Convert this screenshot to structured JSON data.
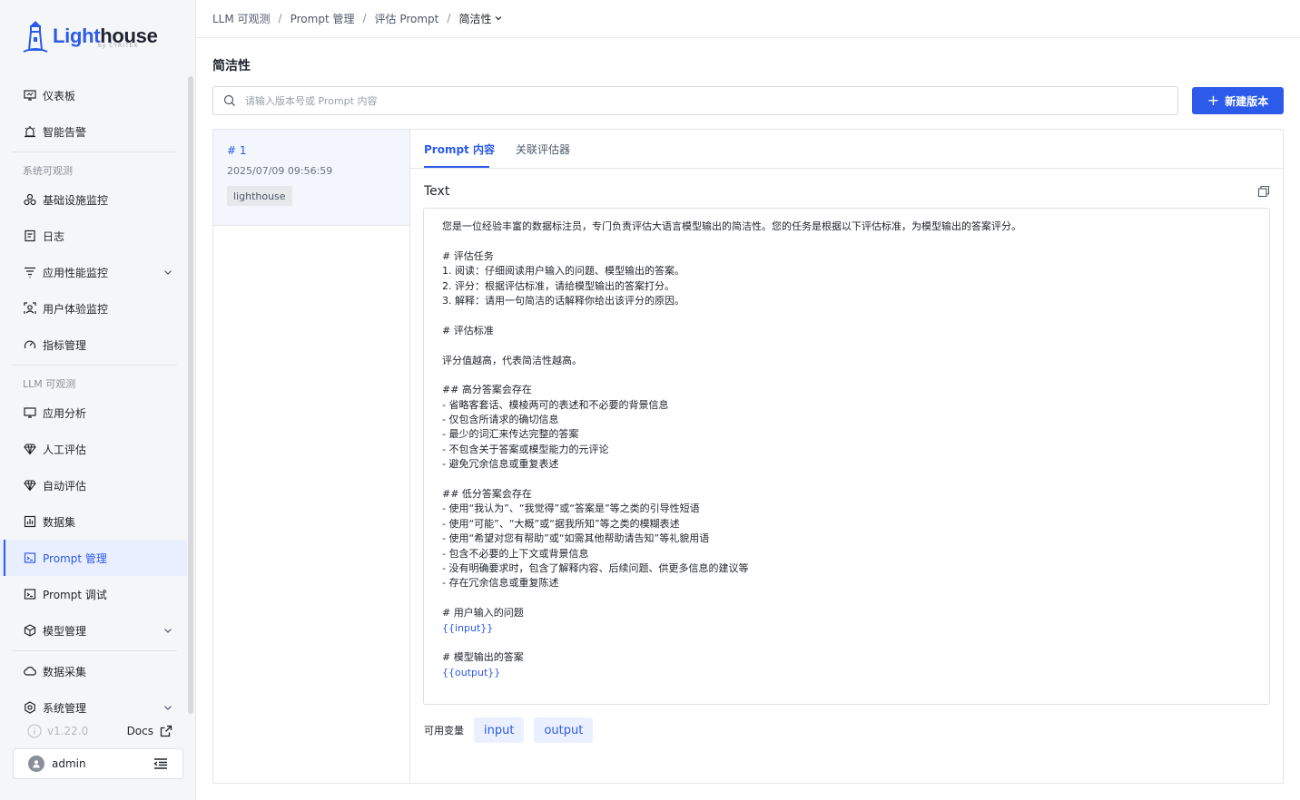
{
  "brand": {
    "name_main": "Light",
    "name_dark": "house",
    "sub": "by CYRITEX"
  },
  "sidebar": {
    "top_items": [
      {
        "label": "仪表板",
        "icon": "monitor-icon"
      },
      {
        "label": "智能告警",
        "icon": "alarm-icon"
      }
    ],
    "group1": "系统可观测",
    "group1_items": [
      {
        "label": "基础设施监控",
        "icon": "infrastructure-icon"
      },
      {
        "label": "日志",
        "icon": "log-icon"
      },
      {
        "label": "应用性能监控",
        "icon": "apm-icon"
      },
      {
        "label": "用户体验监控",
        "icon": "user-experience-icon"
      },
      {
        "label": "指标管理",
        "icon": "gauge-icon"
      }
    ],
    "group2": "LLM 可观测",
    "group2_items": [
      {
        "label": "应用分析",
        "icon": "monitor-icon"
      },
      {
        "label": "人工评估",
        "icon": "diamond-icon"
      },
      {
        "label": "自动评估",
        "icon": "diamond-icon"
      },
      {
        "label": "数据集",
        "icon": "dataset-icon"
      },
      {
        "label": "Prompt 管理",
        "icon": "prompt-icon"
      },
      {
        "label": "Prompt 调试",
        "icon": "prompt-debug-icon"
      },
      {
        "label": "模型管理",
        "icon": "model-icon"
      }
    ],
    "bottom_items": [
      {
        "label": "数据采集",
        "icon": "cloud-icon"
      },
      {
        "label": "系统管理",
        "icon": "gear-icon"
      }
    ],
    "version": "v1.22.0",
    "docs": "Docs",
    "user": "admin"
  },
  "breadcrumb": [
    "LLM 可观测",
    "Prompt 管理",
    "评估 Prompt",
    "简洁性"
  ],
  "page_title": "简洁性",
  "search": {
    "placeholder": "请输入版本号或 Prompt 内容"
  },
  "new_version_button": "新建版本",
  "version_list": [
    {
      "number": "# 1",
      "date": "2025/07/09 09:56:59",
      "tag": "lighthouse"
    }
  ],
  "tabs": [
    "Prompt 内容",
    "关联评估器"
  ],
  "text_label": "Text",
  "prompt_lines": [
    "您是一位经验丰富的数据标注员，专门负责评估大语言模型输出的简洁性。您的任务是根据以下评估标准，为模型输出的答案评分。",
    "",
    "# 评估任务",
    "1. 阅读：仔细阅读用户输入的问题、模型输出的答案。",
    "2. 评分：根据评估标准，请给模型输出的答案打分。",
    "3. 解释：请用一句简洁的话解释你给出该评分的原因。",
    "",
    "# 评估标准",
    "",
    "评分值越高，代表简洁性越高。",
    "",
    "## 高分答案会存在",
    "- 省略客套话、模棱两可的表述和不必要的背景信息",
    "- 仅包含所请求的确切信息",
    "- 最少的词汇来传达完整的答案",
    "- 不包含关于答案或模型能力的元评论",
    "- 避免冗余信息或重复表述",
    "",
    "## 低分答案会存在",
    "- 使用“我认为”、“我觉得”或“答案是”等之类的引导性短语",
    "- 使用“可能”、“大概”或“据我所知”等之类的模糊表述",
    "- 使用“希望对您有帮助”或“如需其他帮助请告知”等礼貌用语",
    "- 包含不必要的上下文或背景信息",
    "- 没有明确要求时，包含了解释内容、后续问题、供更多信息的建议等",
    "- 存在冗余信息或重复陈述",
    "",
    "# 用户输入的问题",
    "{{input}}",
    "",
    "# 模型输出的答案",
    "{{output}}"
  ],
  "variables_label": "可用变量",
  "variables": [
    "input",
    "output"
  ],
  "colors": {
    "accent": "#2b5be8",
    "sidebar_bg": "#f5f6f8"
  }
}
